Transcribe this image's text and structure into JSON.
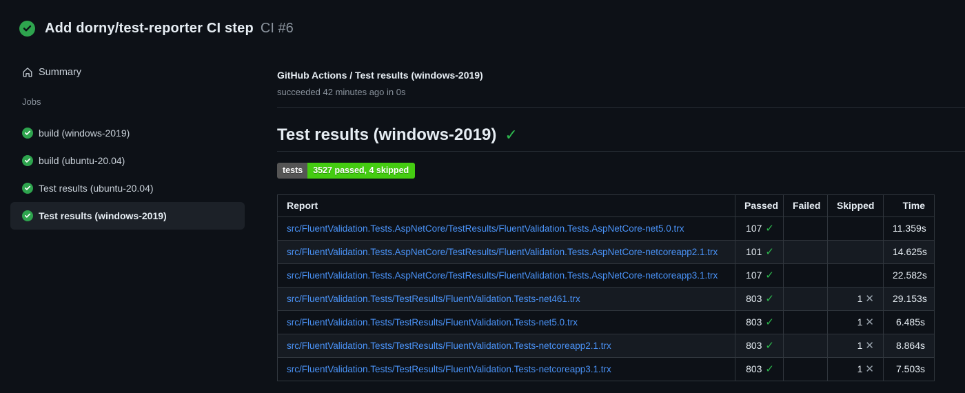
{
  "header": {
    "title": "Add dorny/test-reporter CI step",
    "run_ref": "CI #6"
  },
  "sidebar": {
    "summary_label": "Summary",
    "jobs_heading": "Jobs",
    "jobs": [
      {
        "label": "build (windows-2019)",
        "selected": false
      },
      {
        "label": "build (ubuntu-20.04)",
        "selected": false
      },
      {
        "label": "Test results (ubuntu-20.04)",
        "selected": false
      },
      {
        "label": "Test results (windows-2019)",
        "selected": true
      }
    ]
  },
  "main": {
    "breadcrumb": "GitHub Actions / Test results (windows-2019)",
    "status_line": "succeeded 42 minutes ago in 0s",
    "section_heading": "Test results (windows-2019)",
    "badge": {
      "label": "tests",
      "message": "3527 passed, 4 skipped"
    },
    "table": {
      "columns": [
        "Report",
        "Passed",
        "Failed",
        "Skipped",
        "Time"
      ],
      "rows": [
        {
          "report": "src/FluentValidation.Tests.AspNetCore/TestResults/FluentValidation.Tests.AspNetCore-net5.0.trx",
          "passed": "107",
          "failed": "",
          "skipped": "",
          "time": "11.359s"
        },
        {
          "report": "src/FluentValidation.Tests.AspNetCore/TestResults/FluentValidation.Tests.AspNetCore-netcoreapp2.1.trx",
          "passed": "101",
          "failed": "",
          "skipped": "",
          "time": "14.625s"
        },
        {
          "report": "src/FluentValidation.Tests.AspNetCore/TestResults/FluentValidation.Tests.AspNetCore-netcoreapp3.1.trx",
          "passed": "107",
          "failed": "",
          "skipped": "",
          "time": "22.582s"
        },
        {
          "report": "src/FluentValidation.Tests/TestResults/FluentValidation.Tests-net461.trx",
          "passed": "803",
          "failed": "",
          "skipped": "1",
          "time": "29.153s"
        },
        {
          "report": "src/FluentValidation.Tests/TestResults/FluentValidation.Tests-net5.0.trx",
          "passed": "803",
          "failed": "",
          "skipped": "1",
          "time": "6.485s"
        },
        {
          "report": "src/FluentValidation.Tests/TestResults/FluentValidation.Tests-netcoreapp2.1.trx",
          "passed": "803",
          "failed": "",
          "skipped": "1",
          "time": "8.864s"
        },
        {
          "report": "src/FluentValidation.Tests/TestResults/FluentValidation.Tests-netcoreapp3.1.trx",
          "passed": "803",
          "failed": "",
          "skipped": "1",
          "time": "7.503s"
        }
      ]
    }
  },
  "glyphs": {
    "check": "✓",
    "cross": "✕"
  },
  "colors": {
    "page_bg": "#0d1117",
    "text": "#e6edf3",
    "muted": "#8b949e",
    "green": "#2ea44e",
    "check_green": "#2dba4e",
    "link": "#4a93f8",
    "badge_label": "#555555",
    "badge_value": "#44cc11",
    "table_border": "#30363d",
    "row_alt": "#161b22",
    "selected_bg": "#1c2128"
  }
}
